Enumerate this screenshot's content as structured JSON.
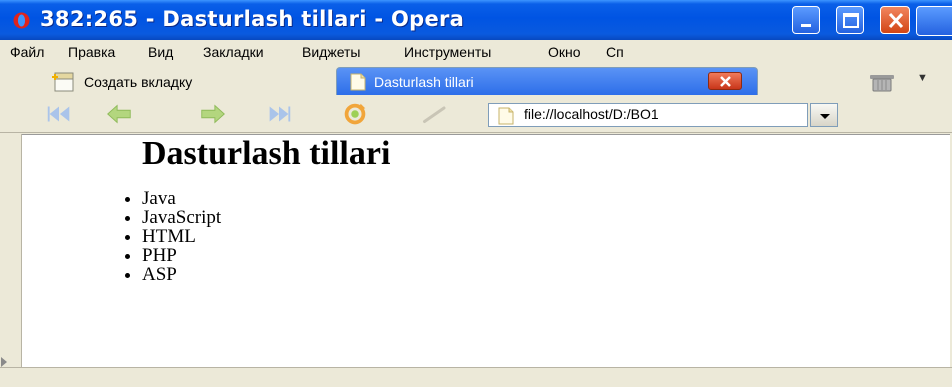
{
  "window": {
    "title": "382:265 - Dasturlash tillari - Opera",
    "titlebar_color": "#0054e3"
  },
  "menu": {
    "items": [
      "Файл",
      "Правка",
      "Вид",
      "Закладки",
      "Виджеты",
      "Инструменты",
      "Окно",
      "Сп"
    ]
  },
  "tabs": {
    "new_tab_label": "Создать вкладку",
    "active_tab_label": "Dasturlash tillari",
    "active_tab_color": "#2d6ee9"
  },
  "toolbar": {
    "buttons": [
      "rewind-icon",
      "back-icon",
      "forward-icon",
      "fast-forward-icon",
      "reload-icon",
      "edit-icon"
    ]
  },
  "address": {
    "value": "file://localhost/D:/BO1"
  },
  "page": {
    "heading": "Dasturlash tillari",
    "items": [
      "Java",
      "JavaScript",
      "HTML",
      "PHP",
      "ASP"
    ]
  }
}
